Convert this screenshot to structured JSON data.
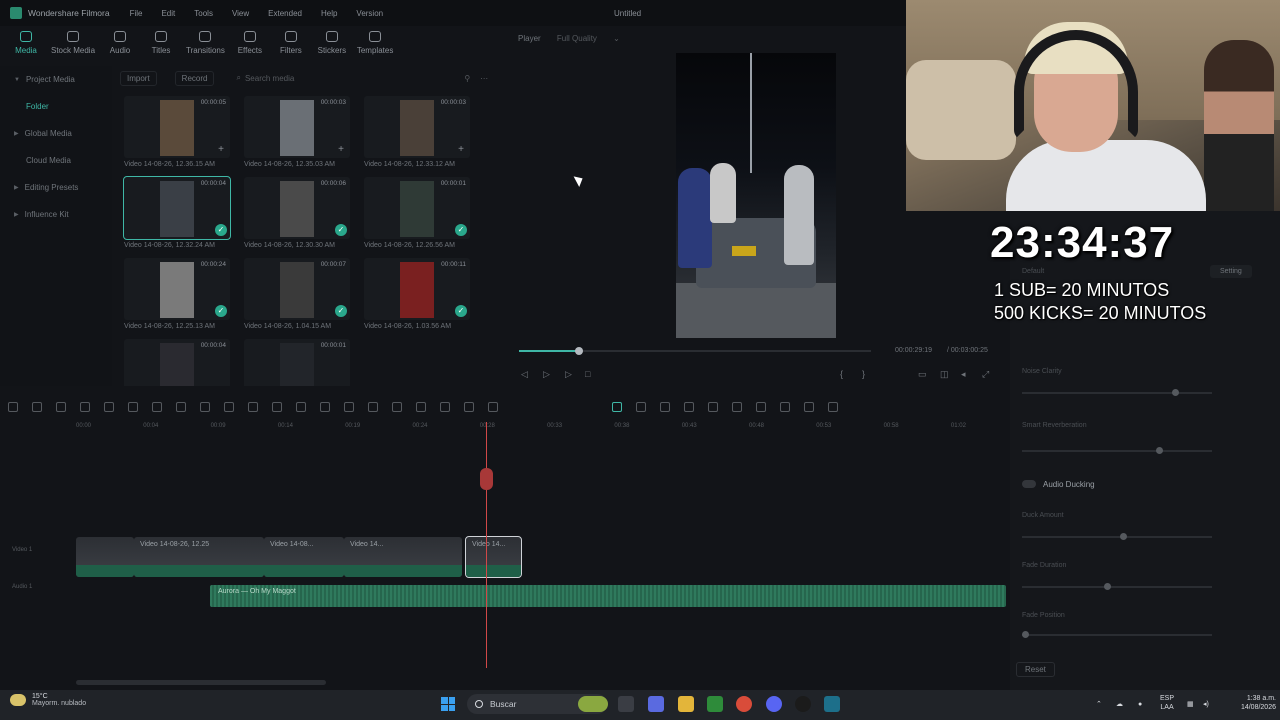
{
  "app": {
    "name": "Wondershare Filmora",
    "menus": [
      "File",
      "Edit",
      "Tools",
      "View",
      "Extended",
      "Help",
      "Version"
    ],
    "doc_title": "Untitled"
  },
  "toolbar": [
    "Media",
    "Stock Media",
    "Audio",
    "Titles",
    "Transitions",
    "Effects",
    "Filters",
    "Stickers",
    "Templates"
  ],
  "sidebar": [
    "Project Media",
    "Folder",
    "Global Media",
    "Cloud Media",
    "Editing Presets",
    "Influence Kit"
  ],
  "mediabar": {
    "import": "Import",
    "record": "Record",
    "search_placeholder": "Search media"
  },
  "clips": [
    {
      "name": "Video 14-08-26, 12.36.15 AM",
      "duration": "00:00:05",
      "state": "plus",
      "color": "#5a4a3a"
    },
    {
      "name": "Video 14-08-26, 12.35.03 AM",
      "duration": "00:00:03",
      "state": "plus",
      "color": "#6a6f75"
    },
    {
      "name": "Video 14-08-26, 12.33.12 AM",
      "duration": "00:00:03",
      "state": "plus",
      "color": "#4a4038"
    },
    {
      "name": "Video 14-08-26, 12.32.24 AM",
      "duration": "00:00:04",
      "state": "check",
      "color": "#3a3f46"
    },
    {
      "name": "Video 14-08-26, 12.30.30 AM",
      "duration": "00:00:06",
      "state": "check",
      "color": "#4a4a4a"
    },
    {
      "name": "Video 14-08-26, 12.26.56 AM",
      "duration": "00:00:01",
      "state": "check",
      "color": "#2f3a36"
    },
    {
      "name": "Video 14-08-26, 12.25.13 AM",
      "duration": "00:00:24",
      "state": "check",
      "color": "#7a7a7a"
    },
    {
      "name": "Video 14-08-26, 1.04.15 AM",
      "duration": "00:00:07",
      "state": "check",
      "color": "#3a3a3a"
    },
    {
      "name": "Video 14-08-26, 1.03.56 AM",
      "duration": "00:00:11",
      "state": "check",
      "color": "#7a2020"
    },
    {
      "name": "",
      "duration": "00:00:04",
      "state": "none",
      "color": "#2a2a30"
    },
    {
      "name": "",
      "duration": "00:00:01",
      "state": "none",
      "color": "#22252a"
    }
  ],
  "player": {
    "label": "Player",
    "quality": "Full Quality",
    "progress": 0.17,
    "current_time": "00:00:29:19",
    "total_time": "/ 00:03:00:25"
  },
  "ruler_ticks": [
    "00:00",
    "00:04",
    "00:09",
    "00:14",
    "00:19",
    "00:24",
    "00:28",
    "00:33",
    "00:38",
    "00:43",
    "00:48",
    "00:53",
    "00:58",
    "01:02"
  ],
  "tracks": {
    "video_label": "Video 1",
    "audio_label": "Audio 1",
    "audio_clip": "Aurora — Oh My Maggot"
  },
  "video_clips": [
    "Video 14-08-...",
    "Video 14-08-26, 12.25",
    "Video 14-08...",
    "Video 14..."
  ],
  "right_panel": {
    "preset": "Default",
    "setting_btn": "Setting",
    "rows": [
      "Noise Clarity",
      "Smart Reverberation",
      "Audio Ducking",
      "Duck Amount",
      "Fade Duration",
      "Fade Position"
    ],
    "reset": "Reset"
  },
  "overlay": {
    "timer": "23:34:37",
    "line1": "1 SUB= 20 MINUTOS",
    "line2": "500 KICKS= 20 MINUTOS"
  },
  "taskbar": {
    "weather_temp": "15°C",
    "weather_desc": "Mayorm. nublado",
    "search": "Buscar",
    "lang1": "ESP",
    "lang2": "LAA",
    "time": "1:38 a.m.",
    "date": "14/08/2026"
  }
}
